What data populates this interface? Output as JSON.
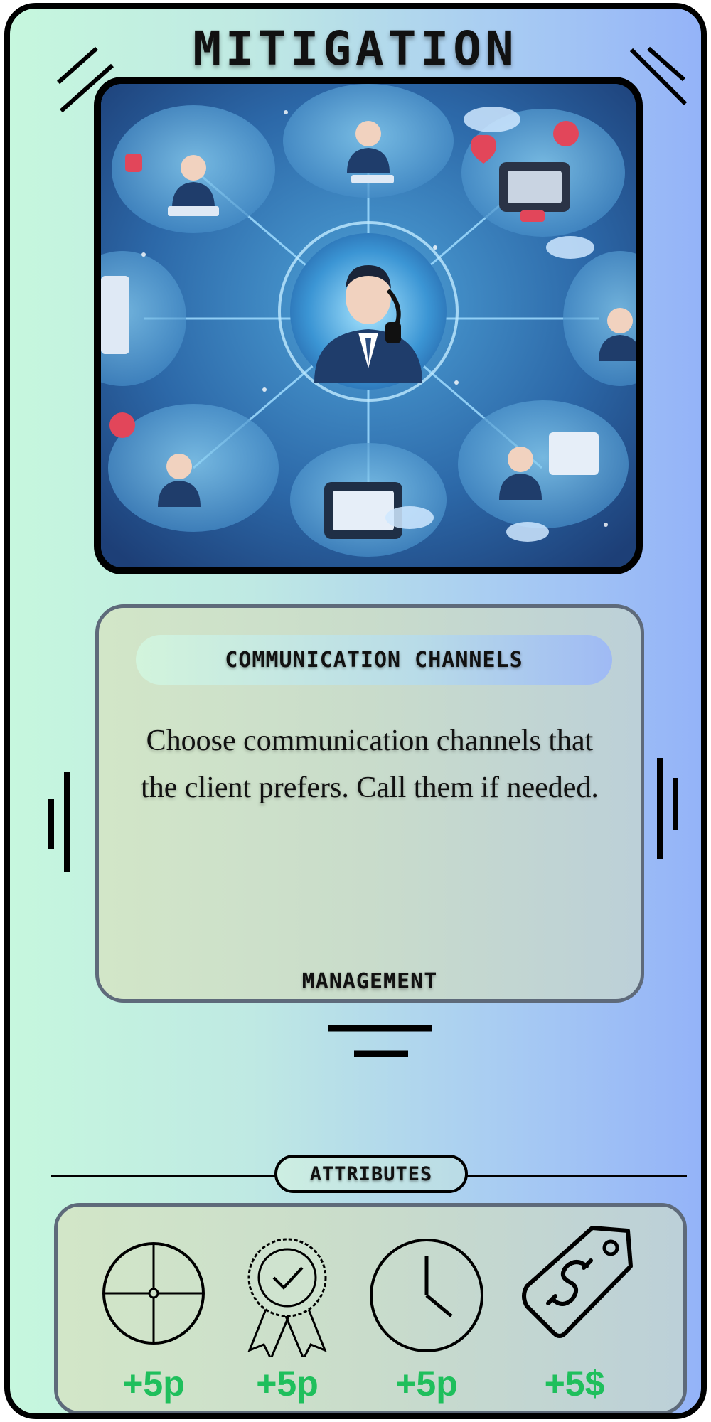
{
  "card": {
    "title": "MITIGATION",
    "art": {
      "icon": "communication-network-illustration"
    },
    "description": {
      "heading": "COMMUNICATION CHANNELS",
      "text_line1": "Choose communication channels that",
      "text_line2": "the client prefers. Call them if needed.",
      "category": "MANAGEMENT"
    },
    "attributes": {
      "label": "ATTRIBUTES",
      "items": [
        {
          "icon": "crosshair-icon",
          "value": "+5p"
        },
        {
          "icon": "award-ribbon-icon",
          "value": "+5p"
        },
        {
          "icon": "clock-icon",
          "value": "+5p"
        },
        {
          "icon": "price-tag-icon",
          "value": "+5$"
        }
      ],
      "value_color": "#1fbf5c"
    },
    "colors": {
      "gradient_start": "#c6f7de",
      "gradient_end": "#94b3f8",
      "border": "#000000"
    }
  }
}
